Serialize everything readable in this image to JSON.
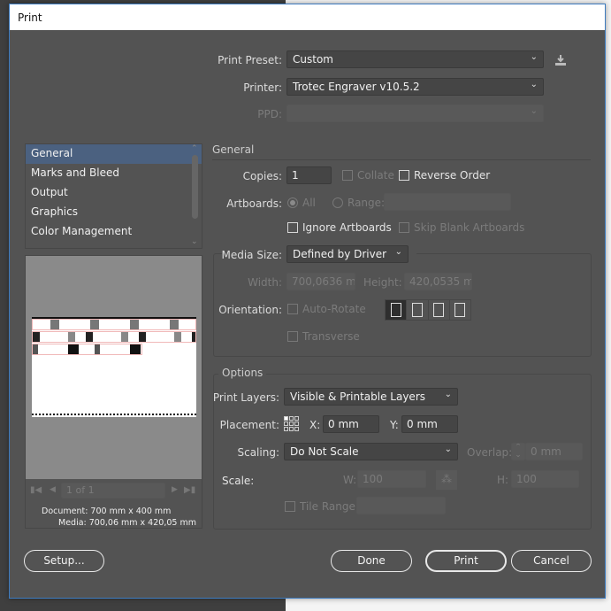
{
  "window": {
    "title": "Print"
  },
  "header": {
    "print_preset_label": "Print Preset:",
    "print_preset_value": "Custom",
    "printer_label": "Printer:",
    "printer_value": "Trotec Engraver v10.5.2",
    "ppd_label": "PPD:",
    "ppd_value": ""
  },
  "sidebar": {
    "items": [
      {
        "label": "General",
        "selected": true
      },
      {
        "label": "Marks and Bleed"
      },
      {
        "label": "Output"
      },
      {
        "label": "Graphics"
      },
      {
        "label": "Color Management"
      }
    ]
  },
  "preview": {
    "page_field": "1 of 1",
    "document": "Document: 700 mm x 400 mm",
    "media": "Media: 700,06 mm x 420,05 mm"
  },
  "general": {
    "section_title": "General",
    "copies_label": "Copies:",
    "copies_value": "1",
    "collate_label": "Collate",
    "reverse_order_label": "Reverse Order",
    "artboards_label": "Artboards:",
    "all_label": "All",
    "range_label": "Range:",
    "ignore_artboards_label": "Ignore Artboards",
    "skip_blank_label": "Skip Blank Artboards"
  },
  "media": {
    "media_size_label": "Media Size:",
    "media_size_value": "Defined by Driver",
    "width_label": "Width:",
    "width_value": "700,0636 mm",
    "height_label": "Height:",
    "height_value": "420,0535 mm",
    "orientation_label": "Orientation:",
    "auto_rotate_label": "Auto-Rotate",
    "transverse_label": "Transverse",
    "orientation_selected": "portrait"
  },
  "options": {
    "section_title": "Options",
    "print_layers_label": "Print Layers:",
    "print_layers_value": "Visible & Printable Layers",
    "placement_label": "Placement:",
    "x_label": "X:",
    "x_value": "0 mm",
    "y_label": "Y:",
    "y_value": "0 mm",
    "scaling_label": "Scaling:",
    "scaling_value": "Do Not Scale",
    "overlap_label": "Overlap:",
    "overlap_value": "0 mm",
    "scale_label": "Scale:",
    "w_label": "W:",
    "w_value": "100",
    "h_label": "H:",
    "h_value": "100",
    "tile_range_label": "Tile Range:"
  },
  "buttons": {
    "setup": "Setup...",
    "done": "Done",
    "print": "Print",
    "cancel": "Cancel"
  },
  "colors": {
    "dialog_bg": "#535353",
    "selection": "#4b6180",
    "accent_border": "#3d7bbf"
  }
}
